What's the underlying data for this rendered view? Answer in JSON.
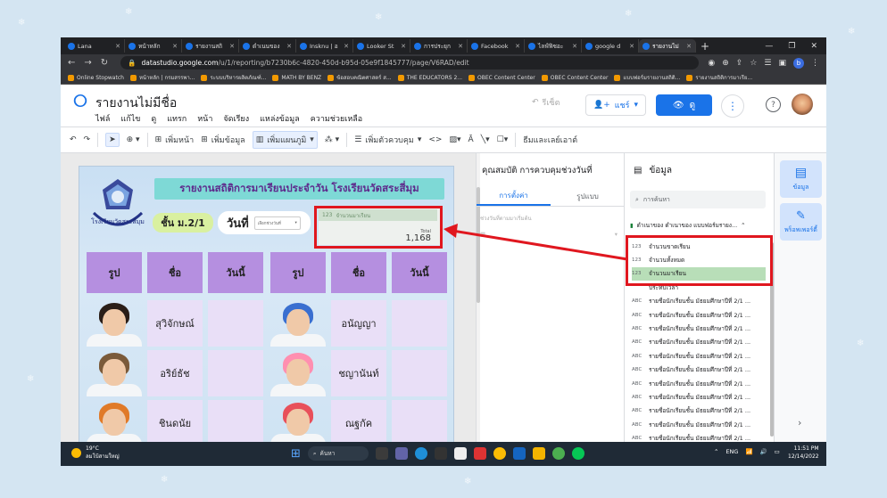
{
  "browser": {
    "tabs": [
      {
        "label": "Lana",
        "active": false
      },
      {
        "label": "หน้าหลัก",
        "active": false
      },
      {
        "label": "รายงานสถิ",
        "active": false
      },
      {
        "label": "ดำเนนของ",
        "active": false
      },
      {
        "label": "Insknu | อ",
        "active": false
      },
      {
        "label": "Looker St",
        "active": false
      },
      {
        "label": "การประยุก",
        "active": false
      },
      {
        "label": "Facebook",
        "active": false
      },
      {
        "label": "ไลฟ์ฟิซอะ",
        "active": false
      },
      {
        "label": "google d",
        "active": false
      },
      {
        "label": "รายงานไม่",
        "active": true
      }
    ],
    "url_host": "datastudio.google.com",
    "url_path": "/u/1/reporting/b7230b6c-4820-450d-b95d-05e9f1845777/page/V6RAD/edit",
    "profile_letter": "b",
    "bookmarks": [
      "Online Stopwatch",
      "หน้าหลัก | กรมสรรพา...",
      "ระบบบริหารผลิตภัณฑ์...",
      "MATH BY BENZ",
      "ข้อสอบคณิตศาสตร์ ส...",
      "THE EDUCATORS 2...",
      "OBEC Content Center",
      "OBEC Content Center",
      "แบบฟอร์มรายงานสถิติ...",
      "รายงานสถิติการมาเรีย..."
    ]
  },
  "app": {
    "report_title": "รายงานไม่มีชื่อ",
    "menu": [
      "ไฟล์",
      "แก้ไข",
      "ดู",
      "แทรก",
      "หน้า",
      "จัดเรียง",
      "แหล่งข้อมูล",
      "ความช่วยเหลือ"
    ],
    "reset_label": "รีเซ็ต",
    "share_label": "แชร์",
    "view_label": "ดู",
    "toolbar": {
      "add_page": "เพิ่มหน้า",
      "add_data": "เพิ่มข้อมูล",
      "add_chart": "เพิ่มแผนภูมิ",
      "add_control": "เพิ่มตัวควบคุม",
      "theme_layout": "ธีมและเลย์เอาต์"
    }
  },
  "report": {
    "header_title": "รายงานสถิติการมาเรียนประจำวัน โรงเรียนวัดสระสี่มุม",
    "emblem_text": "โรงเรียนวัดสระสี่มุม",
    "class_label": "ชั้น ม.2/1",
    "day_label": "วันที่",
    "date_select_placeholder": "เลือกช่วงวันที่",
    "scorecard": {
      "metric_label": "จำนวนมาเรียน",
      "subtitle": "Total",
      "value": "1,168"
    },
    "columns": [
      "รูป",
      "ชื่อ",
      "วันนี้",
      "รูป",
      "ชื่อ",
      "วันนี้"
    ],
    "students_left": [
      "สุวิจักษณ์",
      "อริย์ธัช",
      "ชินดนัย"
    ],
    "students_right": [
      "อนัญญา",
      "ชญานันท์",
      "ณฐกัค"
    ]
  },
  "properties_panel": {
    "title": "คุณสมบัติ การควบคุมช่วงวันที่",
    "tab_setup": "การตั้งค่า",
    "tab_style": "รูปแบบ",
    "field_label": "ช่วงวันที่ตามมาเริ่มต้น"
  },
  "data_panel": {
    "title": "ข้อมูล",
    "search_placeholder": "การค้นหา",
    "source_name": "ดำเนาของ ดำเนาของ แบบฟอร์มรายง...",
    "fields": [
      {
        "type": "123",
        "name": "จำนวนขาดเรียน",
        "highlight": false
      },
      {
        "type": "123",
        "name": "จำนวนทั้งหมด",
        "highlight": false
      },
      {
        "type": "123",
        "name": "จำนวนมาเรียน",
        "highlight": true
      },
      {
        "type": "",
        "name": "ประทับเวลา",
        "highlight": false
      },
      {
        "type": "ABC",
        "name": "รายชื่อนักเรียนชั้น มัธยมศึกษาปีที่ 2/1 ...",
        "highlight": false
      },
      {
        "type": "ABC",
        "name": "รายชื่อนักเรียนชั้น มัธยมศึกษาปีที่ 2/1 ...",
        "highlight": false
      },
      {
        "type": "ABC",
        "name": "รายชื่อนักเรียนชั้น มัธยมศึกษาปีที่ 2/1 ...",
        "highlight": false
      },
      {
        "type": "ABC",
        "name": "รายชื่อนักเรียนชั้น มัธยมศึกษาปีที่ 2/1 ...",
        "highlight": false
      },
      {
        "type": "ABC",
        "name": "รายชื่อนักเรียนชั้น มัธยมศึกษาปีที่ 2/1 ...",
        "highlight": false
      },
      {
        "type": "ABC",
        "name": "รายชื่อนักเรียนชั้น มัธยมศึกษาปีที่ 2/1 ...",
        "highlight": false
      },
      {
        "type": "ABC",
        "name": "รายชื่อนักเรียนชั้น มัธยมศึกษาปีที่ 2/1 ...",
        "highlight": false
      },
      {
        "type": "ABC",
        "name": "รายชื่อนักเรียนชั้น มัธยมศึกษาปีที่ 2/1 ...",
        "highlight": false
      },
      {
        "type": "ABC",
        "name": "รายชื่อนักเรียนชั้น มัธยมศึกษาปีที่ 2/1 ...",
        "highlight": false
      },
      {
        "type": "ABC",
        "name": "รายชื่อนักเรียนชั้น มัธยมศึกษาปีที่ 2/1 ...",
        "highlight": false
      },
      {
        "type": "ABC",
        "name": "รายชื่อนักเรียนชั้น มัธยมศึกษาปีที่ 2/1 ...",
        "highlight": false
      }
    ]
  },
  "side_rail": {
    "data_label": "ข้อมูล",
    "properties_label": "พร็อพเพอร์ตี้"
  },
  "taskbar": {
    "temperature": "19°C",
    "weather_text": "ลมโบ้สามใหญ่",
    "search_label": "ค้นหา",
    "language": "ENG",
    "time": "11:51 PM",
    "date": "12/14/2022"
  },
  "colors": {
    "annotation_red": "#e0171f",
    "accent": "#1a73e8",
    "header_bar": "#7ed9d6",
    "column_header": "#b58fe0",
    "cell": "#e9dff7"
  }
}
